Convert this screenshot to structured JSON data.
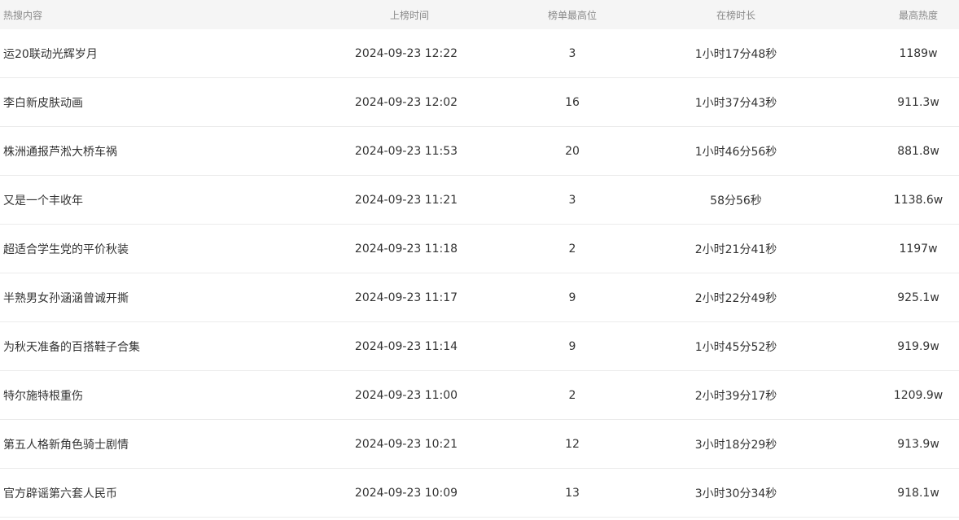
{
  "table": {
    "headers": {
      "topic": "热搜内容",
      "time": "上榜时间",
      "rank": "榜单最高位",
      "duration": "在榜时长",
      "heat": "最高热度"
    },
    "rows": [
      {
        "topic": "运20联动光辉岁月",
        "time": "2024-09-23 12:22",
        "rank": "3",
        "duration": "1小时17分48秒",
        "heat": "1189w"
      },
      {
        "topic": "李白新皮肤动画",
        "time": "2024-09-23 12:02",
        "rank": "16",
        "duration": "1小时37分43秒",
        "heat": "911.3w"
      },
      {
        "topic": "株洲通报芦淞大桥车祸",
        "time": "2024-09-23 11:53",
        "rank": "20",
        "duration": "1小时46分56秒",
        "heat": "881.8w"
      },
      {
        "topic": "又是一个丰收年",
        "time": "2024-09-23 11:21",
        "rank": "3",
        "duration": "58分56秒",
        "heat": "1138.6w"
      },
      {
        "topic": "超适合学生党的平价秋装",
        "time": "2024-09-23 11:18",
        "rank": "2",
        "duration": "2小时21分41秒",
        "heat": "1197w"
      },
      {
        "topic": "半熟男女孙涵涵曾诚开撕",
        "time": "2024-09-23 11:17",
        "rank": "9",
        "duration": "2小时22分49秒",
        "heat": "925.1w"
      },
      {
        "topic": "为秋天准备的百搭鞋子合集",
        "time": "2024-09-23 11:14",
        "rank": "9",
        "duration": "1小时45分52秒",
        "heat": "919.9w"
      },
      {
        "topic": "特尔施特根重伤",
        "time": "2024-09-23 11:00",
        "rank": "2",
        "duration": "2小时39分17秒",
        "heat": "1209.9w"
      },
      {
        "topic": "第五人格新角色骑士剧情",
        "time": "2024-09-23 10:21",
        "rank": "12",
        "duration": "3小时18分29秒",
        "heat": "913.9w"
      },
      {
        "topic": "官方辟谣第六套人民币",
        "time": "2024-09-23 10:09",
        "rank": "13",
        "duration": "3小时30分34秒",
        "heat": "918.1w"
      }
    ]
  }
}
